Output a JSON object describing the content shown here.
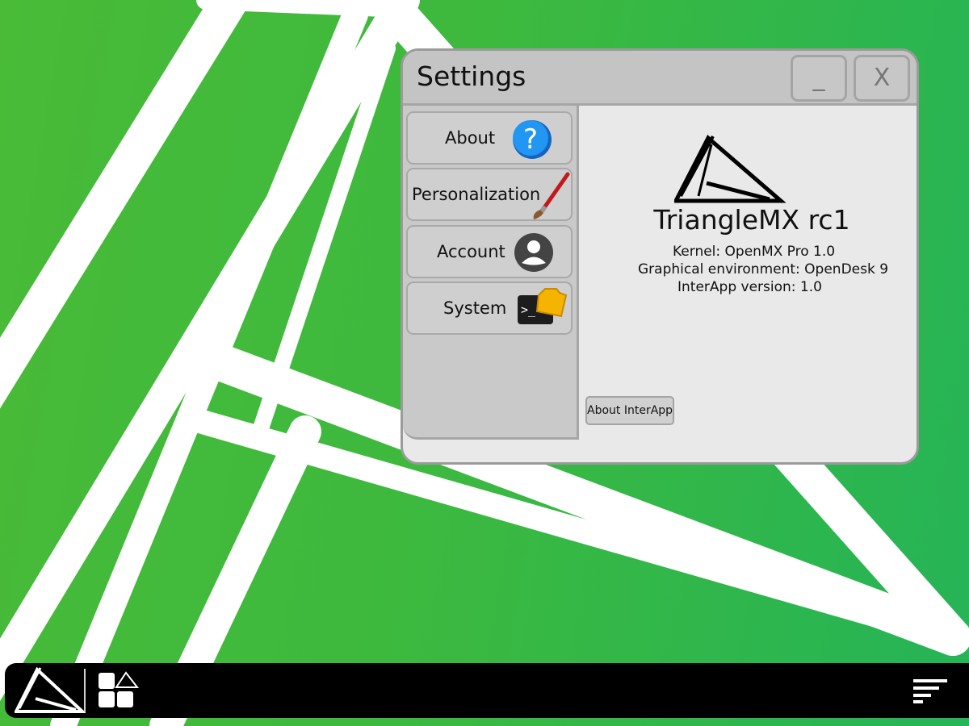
{
  "window": {
    "title": "Settings",
    "minimize_label": "_",
    "close_label": "X"
  },
  "sidebar": {
    "items": [
      {
        "label": "About",
        "icon": "question-icon"
      },
      {
        "label": "Personalization",
        "icon": "paintbrush-icon"
      },
      {
        "label": "Account",
        "icon": "user-avatar-icon"
      },
      {
        "label": "System",
        "icon": "terminal-folder-icon"
      }
    ]
  },
  "content": {
    "logo": "trianglemx-logo",
    "os_name": "TriangleMX rc1",
    "kernel": "Kernel: OpenMX Pro 1.0",
    "graphical_environment": "Graphical environment: OpenDesk 9",
    "interapp_version": "InterApp version: 1.0",
    "about_interapp_button": "About InterApp"
  },
  "taskbar": {
    "start_icon": "trianglemx-logo",
    "apps_icon": "app-grid-icon",
    "menu_icon": "menu-lines-icon"
  },
  "colors": {
    "desktop_green": "#3db93e",
    "window_background": "#e9e9e9",
    "sidebar_background": "#c9c9c9",
    "taskbar": "#000000",
    "about_icon_blue": "#1e88e5",
    "brush_red": "#c21a1a",
    "folder_yellow": "#f5b400"
  }
}
